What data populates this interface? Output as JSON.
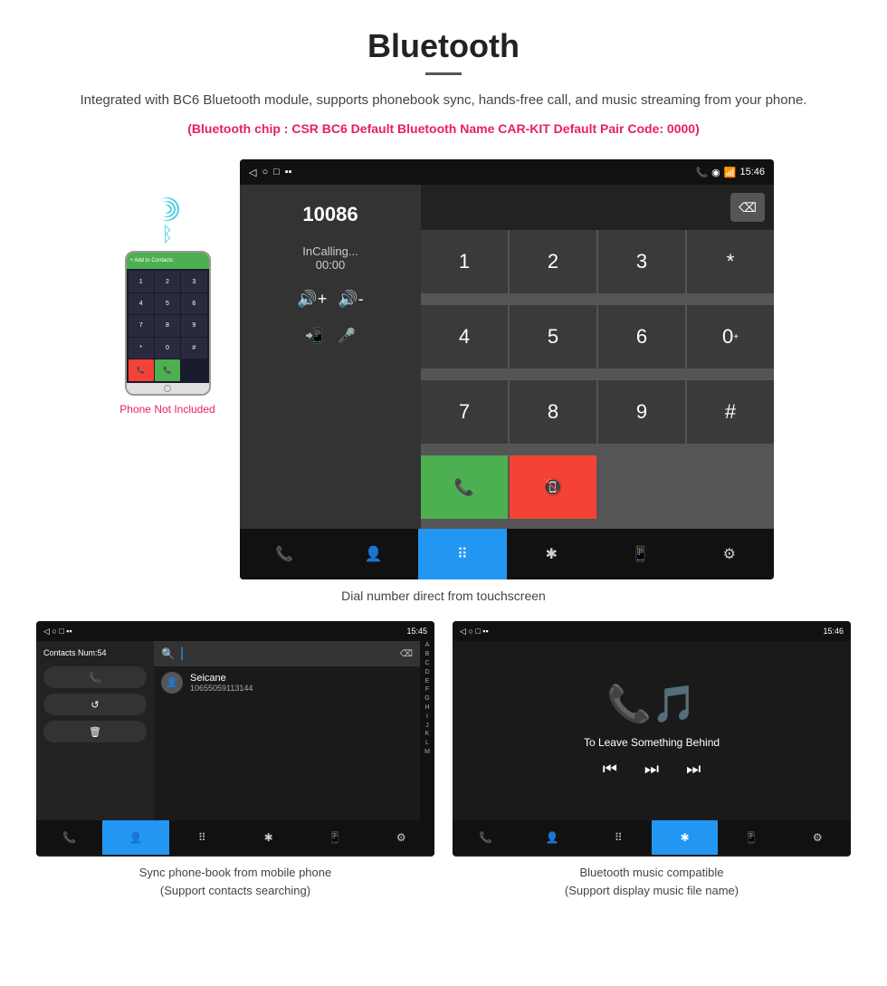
{
  "header": {
    "title": "Bluetooth",
    "description": "Integrated with BC6 Bluetooth module, supports phonebook sync, hands-free call, and music streaming from your phone.",
    "specs": "(Bluetooth chip : CSR BC6    Default Bluetooth Name CAR-KIT    Default Pair Code: 0000)"
  },
  "phone_aside": {
    "label": "Phone Not Included"
  },
  "large_screen": {
    "status_bar": {
      "time": "15:46",
      "icons_left": [
        "◁",
        "○",
        "□",
        "▪▪"
      ],
      "icons_right": [
        "📞",
        "◉",
        "📶",
        "15:46"
      ]
    },
    "dialed_number": "10086",
    "call_status": "InCalling...",
    "call_timer": "00:00",
    "keypad_keys": [
      "1",
      "2",
      "3",
      "*",
      "4",
      "5",
      "6",
      "0+",
      "7",
      "8",
      "9",
      "#"
    ],
    "caption": "Dial number direct from touchscreen"
  },
  "phonebook_screen": {
    "status_time": "15:45",
    "contacts_num": "Contacts Num:54",
    "contact_name": "Seicane",
    "contact_number": "10655059113144",
    "alpha_letters": [
      "A",
      "B",
      "C",
      "D",
      "E",
      "F",
      "G",
      "H",
      "I",
      "J",
      "K",
      "L",
      "M"
    ],
    "caption_line1": "Sync phone-book from mobile phone",
    "caption_line2": "(Support contacts searching)"
  },
  "music_screen": {
    "status_time": "15:46",
    "song_title": "To Leave Something Behind",
    "caption_line1": "Bluetooth music compatible",
    "caption_line2": "(Support display music file name)"
  },
  "nav_items": [
    {
      "icon": "📞",
      "label": "call"
    },
    {
      "icon": "👤",
      "label": "contacts"
    },
    {
      "icon": "⠿",
      "label": "keypad"
    },
    {
      "icon": "✱",
      "label": "bluetooth"
    },
    {
      "icon": "📱",
      "label": "phone"
    },
    {
      "icon": "⚙",
      "label": "settings"
    }
  ]
}
